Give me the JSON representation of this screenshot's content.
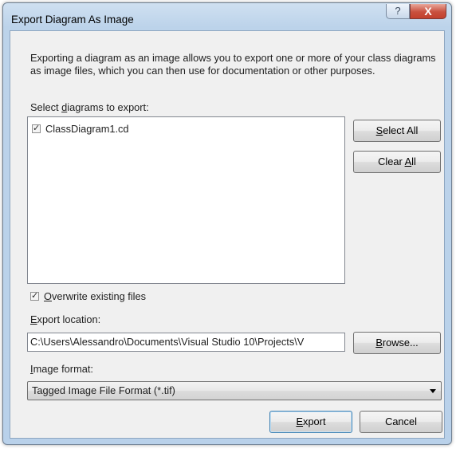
{
  "window": {
    "title": "Export Diagram As Image",
    "help_glyph": "?",
    "close_glyph": "X"
  },
  "description": "Exporting a diagram as an image allows you to export one or more of your class diagrams as image files, which you can then use for documentation or other purposes.",
  "diagrams": {
    "label_pre": "Select ",
    "label_accel": "d",
    "label_post": "iagrams to export:",
    "items": [
      {
        "label": "ClassDiagram1.cd",
        "checked": true
      }
    ],
    "select_all": {
      "pre": "",
      "accel": "S",
      "post": "elect All"
    },
    "clear_all": {
      "pre": "Clear ",
      "accel": "A",
      "post": "ll"
    }
  },
  "overwrite": {
    "checked": true,
    "pre": "",
    "accel": "O",
    "post": "verwrite existing files"
  },
  "location": {
    "label_pre": "",
    "label_accel": "E",
    "label_post": "xport location:",
    "value": "C:\\Users\\Alessandro\\Documents\\Visual Studio 10\\Projects\\V",
    "browse": {
      "pre": "",
      "accel": "B",
      "post": "rowse..."
    }
  },
  "format": {
    "label_pre": "",
    "label_accel": "I",
    "label_post": "mage format:",
    "selected": "Tagged Image File Format (*.tif)"
  },
  "actions": {
    "export": {
      "pre": "",
      "accel": "E",
      "post": "xport"
    },
    "cancel": "Cancel"
  }
}
